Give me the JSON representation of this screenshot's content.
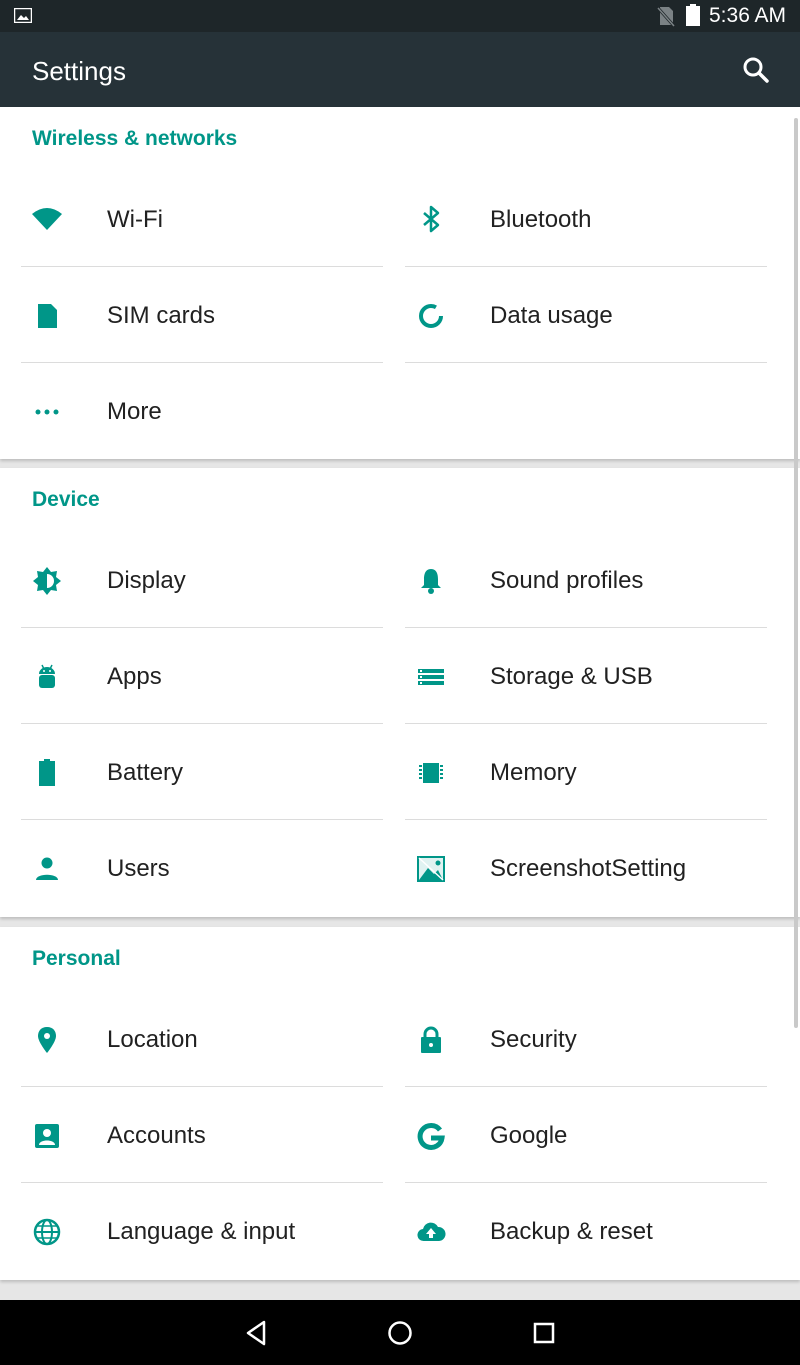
{
  "status_bar": {
    "time": "5:36 AM",
    "icons": [
      "gallery-icon",
      "no-sim-icon",
      "battery-icon"
    ]
  },
  "toolbar": {
    "title": "Settings",
    "search_icon": "search-icon"
  },
  "theme": {
    "accent": "#009688",
    "toolbar": "#263238",
    "statusbar": "#1e2629"
  },
  "sections": {
    "wireless": {
      "title": "Wireless & networks",
      "items": [
        {
          "label": "Wi-Fi",
          "icon": "wifi-icon"
        },
        {
          "label": "Bluetooth",
          "icon": "bluetooth-icon"
        },
        {
          "label": "SIM cards",
          "icon": "sim-card-icon"
        },
        {
          "label": "Data usage",
          "icon": "data-usage-icon"
        },
        {
          "label": "More",
          "icon": "more-dots-icon"
        }
      ]
    },
    "device": {
      "title": "Device",
      "items": [
        {
          "label": "Display",
          "icon": "brightness-icon"
        },
        {
          "label": "Sound profiles",
          "icon": "bell-icon"
        },
        {
          "label": "Apps",
          "icon": "android-icon"
        },
        {
          "label": "Storage & USB",
          "icon": "storage-icon"
        },
        {
          "label": "Battery",
          "icon": "battery-icon"
        },
        {
          "label": "Memory",
          "icon": "memory-chip-icon"
        },
        {
          "label": "Users",
          "icon": "person-icon"
        },
        {
          "label": "ScreenshotSetting",
          "icon": "screenshot-icon"
        }
      ]
    },
    "personal": {
      "title": "Personal",
      "items": [
        {
          "label": "Location",
          "icon": "location-pin-icon"
        },
        {
          "label": "Security",
          "icon": "lock-icon"
        },
        {
          "label": "Accounts",
          "icon": "account-box-icon"
        },
        {
          "label": "Google",
          "icon": "google-g-icon"
        },
        {
          "label": "Language & input",
          "icon": "globe-icon"
        },
        {
          "label": "Backup & reset",
          "icon": "cloud-upload-icon"
        }
      ]
    }
  },
  "nav_bar": {
    "icons": [
      "back-icon",
      "home-icon",
      "recents-icon"
    ]
  }
}
